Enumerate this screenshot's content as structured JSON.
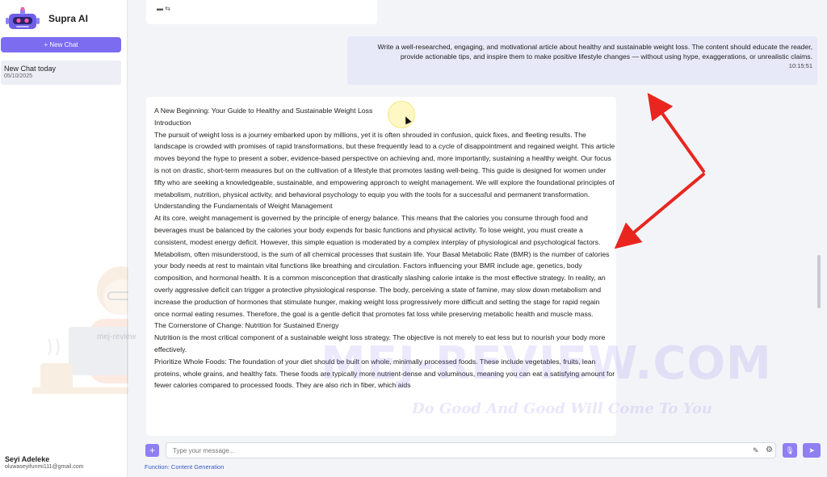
{
  "app": {
    "name": "Supra AI"
  },
  "sidebar": {
    "new_chat_label": "+ New Chat",
    "chats": [
      {
        "title": "New Chat today",
        "date": "05/10/2025"
      }
    ],
    "user": {
      "name": "Seyi Adeleke",
      "email": "oluwaseyifunmi111@gmail.com"
    }
  },
  "conversation": {
    "user_message": {
      "text": "Write a well-researched, engaging, and motivational article about healthy and sustainable weight loss. The content should educate the reader, provide actionable tips, and inspire them to make positive lifestyle changes — without using hype, exaggerations, or unrealistic claims.",
      "time": "10:15:51"
    },
    "response": [
      "A New Beginning: Your Guide to Healthy and Sustainable Weight Loss",
      "Introduction",
      "The pursuit of weight loss is a journey embarked upon by millions, yet it is often shrouded in confusion, quick fixes, and fleeting results. The landscape is crowded with promises of rapid transformations, but these frequently lead to a cycle of disappointment and regained weight. This article moves beyond the hype to present a sober, evidence-based perspective on achieving and, more importantly, sustaining a healthy weight. Our focus is not on drastic, short-term measures but on the cultivation of a lifestyle that promotes lasting well-being. This guide is designed for women under fifty who are seeking a knowledgeable, sustainable, and empowering approach to weight management. We will explore the foundational principles of metabolism, nutrition, physical activity, and behavioral psychology to equip you with the tools for a successful and permanent transformation.",
      "Understanding the Fundamentals of Weight Management",
      "At its core, weight management is governed by the principle of energy balance. This means that the calories you consume through food and beverages must be balanced by the calories your body expends for basic functions and physical activity. To lose weight, you must create a consistent, modest energy deficit. However, this simple equation is moderated by a complex interplay of physiological and psychological factors.",
      "Metabolism, often misunderstood, is the sum of all chemical processes that sustain life. Your Basal Metabolic Rate (BMR) is the number of calories your body needs at rest to maintain vital functions like breathing and circulation. Factors influencing your BMR include age, genetics, body composition, and hormonal health. It is a common misconception that drastically slashing calorie intake is the most effective strategy. In reality, an overly aggressive deficit can trigger a protective physiological response. The body, perceiving a state of famine, may slow down metabolism and increase the production of hormones that stimulate hunger, making weight loss progressively more difficult and setting the stage for rapid regain once normal eating resumes. Therefore, the goal is a gentle deficit that promotes fat loss while preserving metabolic health and muscle mass.",
      "The Cornerstone of Change: Nutrition for Sustained Energy",
      "Nutrition is the most critical component of a sustainable weight loss strategy. The objective is not merely to eat less but to nourish your body more effectively.",
      "Prioritize Whole Foods: The foundation of your diet should be built on whole, minimally processed foods. These include vegetables, fruits, lean proteins, whole grains, and healthy fats. These foods are typically more nutrient-dense and voluminous, meaning you can eat a satisfying amount for fewer calories compared to processed foods. They are also rich in fiber, which aids"
    ]
  },
  "composer": {
    "placeholder": "Type your message...",
    "function_label": "Function: Content Generation"
  },
  "watermark": {
    "site": "MEJ-REVIEW.COM",
    "tagline": "Do Good And Good Will Come To You",
    "small": "mej-review"
  },
  "colors": {
    "accent": "#7b6cf0",
    "annotation_arrow": "#e8261f"
  }
}
